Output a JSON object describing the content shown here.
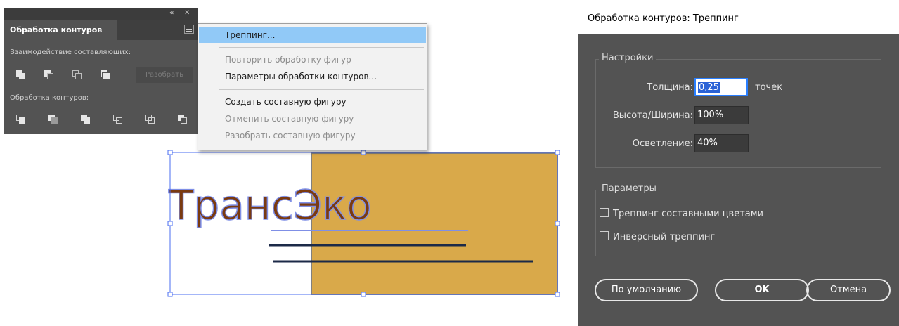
{
  "pathfinder_panel": {
    "collapse_glyph": "«",
    "close_glyph": "✕",
    "tab_label": "Обработка контуров",
    "shape_modes_label": "Взаимодействие составляющих:",
    "pathfinders_label": "Обработка контуров:",
    "expand_label": "Разобрать"
  },
  "menu": {
    "items": [
      {
        "label": "Треппинг...",
        "state": "highlighted"
      },
      {
        "label": "Повторить обработку фигур",
        "state": "disabled"
      },
      {
        "label": "Параметры обработки контуров...",
        "state": "enabled"
      },
      {
        "label": "Создать составную фигуру",
        "state": "enabled"
      },
      {
        "label": "Отменить составную фигуру",
        "state": "disabled"
      },
      {
        "label": "Разобрать составную фигуру",
        "state": "disabled"
      }
    ]
  },
  "artwork": {
    "logo_text": "ТрансЭко",
    "colors": {
      "rect_fill": "#d9a94a",
      "text_fill": "#7a3a10",
      "text_outline": "#7f8fe6",
      "selection": "#4a6cf0",
      "line": "#1c2a48"
    }
  },
  "dialog": {
    "title": "Обработка контуров: Треппинг",
    "settings_legend": "Настройки",
    "thickness_label": "Толщина:",
    "thickness_value": "0,25",
    "thickness_unit": "точек",
    "height_width_label": "Высота/Ширина:",
    "height_width_value": "100%",
    "tint_label": "Осветление:",
    "tint_value": "40%",
    "options_legend": "Параметры",
    "traps_process_color": "Треппинг составными цветами",
    "reverse_traps": "Инверсный треппинг",
    "defaults_button": "По умолчанию",
    "ok_button": "OK",
    "cancel_button": "Отмена"
  }
}
